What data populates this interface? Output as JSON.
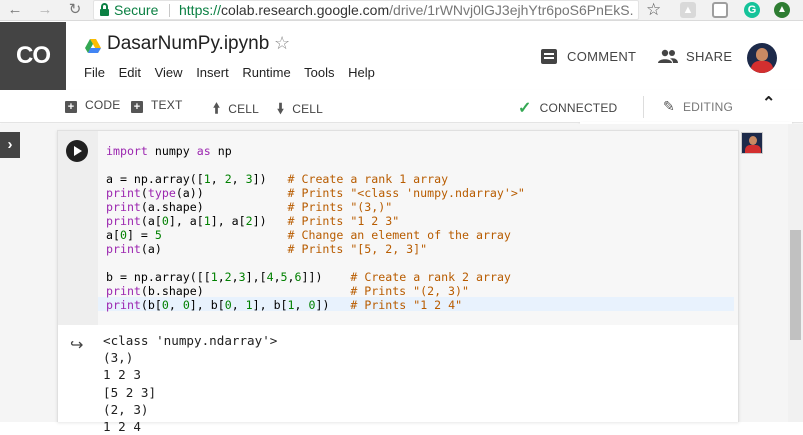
{
  "browser": {
    "security_label": "Secure",
    "url_scheme": "https://",
    "url_host": "colab.research.google.com",
    "url_path": "/drive/1rWNvj0lGJ3ejhYtr6poS6PnEkS..."
  },
  "header": {
    "logo": "CO",
    "doc_title": "DasarNumPy.ipynb",
    "menus": [
      "File",
      "Edit",
      "View",
      "Insert",
      "Runtime",
      "Tools",
      "Help"
    ],
    "comment_label": "COMMENT",
    "share_label": "SHARE"
  },
  "toolbar": {
    "code_label": "CODE",
    "text_label": "TEXT",
    "cell_up_label": "CELL",
    "cell_down_label": "CELL",
    "status_label": "CONNECTED",
    "mode_label": "EDITING"
  },
  "cell": {
    "output_lines": [
      "<class 'numpy.ndarray'>",
      "(3,)",
      "1 2 3",
      "[5 2 3]",
      "(2, 3)",
      "1 2 4"
    ]
  }
}
